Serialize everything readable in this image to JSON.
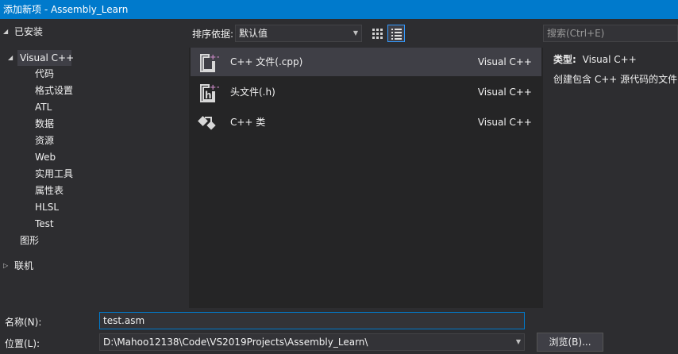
{
  "window": {
    "title": "添加新项 - Assembly_Learn"
  },
  "tree": {
    "installed": {
      "label": "已安装",
      "expanded": true
    },
    "visual_cpp": {
      "label": "Visual C++",
      "expanded": true
    },
    "children": [
      "代码",
      "格式设置",
      "ATL",
      "数据",
      "资源",
      "Web",
      "实用工具",
      "属性表",
      "HLSL",
      "Test"
    ],
    "graphics": "图形",
    "online": {
      "label": "联机",
      "expanded": false
    }
  },
  "toolbar": {
    "sort_label": "排序依据:",
    "sort_value": "默认值"
  },
  "search": {
    "placeholder": "搜索(Ctrl+E)"
  },
  "items": [
    {
      "name": "C++ 文件(.cpp)",
      "lang": "Visual C++",
      "icon": "cpp-file-icon"
    },
    {
      "name": "头文件(.h)",
      "lang": "Visual C++",
      "icon": "header-file-icon"
    },
    {
      "name": "C++ 类",
      "lang": "Visual C++",
      "icon": "cpp-class-icon"
    }
  ],
  "details": {
    "type_label": "类型:",
    "type_value": "Visual C++",
    "description": "创建包含 C++ 源代码的文件"
  },
  "form": {
    "name_label": "名称(N):",
    "name_value": "test.asm",
    "location_label": "位置(L):",
    "location_value": "D:\\Mahoo12138\\Code\\VS2019Projects\\Assembly_Learn\\",
    "browse_label": "浏览(B)..."
  },
  "colors": {
    "accent": "#007acc",
    "background": "#2d2d30",
    "list_bg": "#252526",
    "selection": "#3f3f46"
  }
}
